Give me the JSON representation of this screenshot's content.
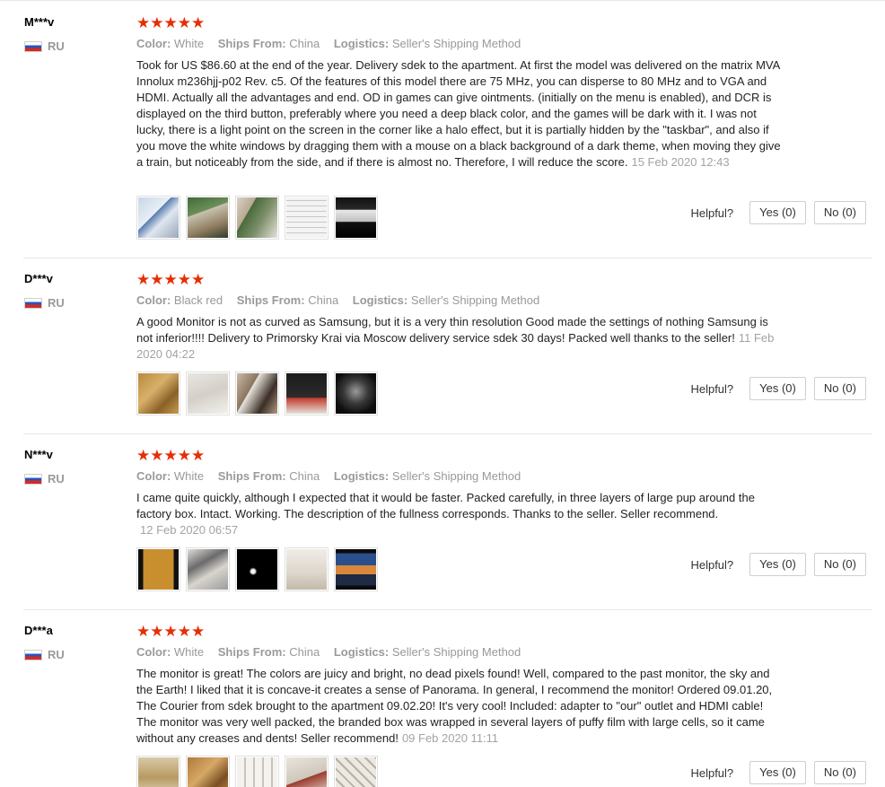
{
  "reviews": [
    {
      "user": "M***v",
      "country": "RU",
      "rating": "★★★★★",
      "color_label": "Color:",
      "color": "White",
      "ships_label": "Ships From:",
      "ships": "China",
      "logistics_label": "Logistics:",
      "logistics": "Seller's Shipping Method",
      "text": "Took for US $86.60 at the end of the year. Delivery sdek to the apartment. At first the model was delivered on the matrix MVA Innolux m236hjj-p02 Rev. c5. Of the features of this model there are 75 MHz, you can disperse to 80 MHz and to VGA and HDMI. Actually all the advantages and end. OD in games can give ointments. (initially on the menu is enabled), and DCR is displayed on the third button, preferably where you need a deep black color, and the games will be dark with it. I was not lucky, there is a light point on the screen in the corner like a halo effect, but it is partially hidden by the \"taskbar\", and also if you move the white windows by dragging them with a mouse on a black background of a dark theme, when moving they give a train, but noticeably from the side, and if there is almost no. Therefore, I will reduce the score.",
      "date": "15 Feb 2020 12:43",
      "helpful_label": "Helpful?",
      "yes_label": "Yes (0)",
      "no_label": "No (0)"
    },
    {
      "user": "D***v",
      "country": "RU",
      "rating": "★★★★★",
      "color_label": "Color:",
      "color": "Black red",
      "ships_label": "Ships From:",
      "ships": "China",
      "logistics_label": "Logistics:",
      "logistics": "Seller's Shipping Method",
      "text": "A good Monitor is not as curved as Samsung, but it is a very thin resolution Good made the settings of nothing Samsung is not inferior!!!! Delivery to Primorsky Krai via Moscow delivery service sdek 30 days! Packed well thanks to the seller!",
      "date": "11 Feb 2020 04:22",
      "helpful_label": "Helpful?",
      "yes_label": "Yes (0)",
      "no_label": "No (0)"
    },
    {
      "user": "N***v",
      "country": "RU",
      "rating": "★★★★★",
      "color_label": "Color:",
      "color": "White",
      "ships_label": "Ships From:",
      "ships": "China",
      "logistics_label": "Logistics:",
      "logistics": "Seller's Shipping Method",
      "text": "I came quite quickly, although I expected that it would be faster. Packed carefully, in three layers of large pup around the factory box. Intact. Working. The description of the fullness corresponds. Thanks to the seller. Seller recommend.",
      "date": "12 Feb 2020 06:57",
      "helpful_label": "Helpful?",
      "yes_label": "Yes (0)",
      "no_label": "No (0)"
    },
    {
      "user": "D***a",
      "country": "RU",
      "rating": "★★★★★",
      "color_label": "Color:",
      "color": "White",
      "ships_label": "Ships From:",
      "ships": "China",
      "logistics_label": "Logistics:",
      "logistics": "Seller's Shipping Method",
      "text": "The monitor is great! The colors are juicy and bright, no dead pixels found! Well, compared to the past monitor, the sky and the Earth! I liked that it is concave-it creates a sense of Panorama. In general, I recommend the monitor! Ordered 09.01.20, The Courier from sdek brought to the apartment 09.02.20! It's very cool! Included: adapter to \"our\" outlet and HDMI cable! The monitor was very well packed, the branded box was wrapped in several layers of puffy film with large cells, so it came without any creases and dents! Seller recommend!",
      "date": "09 Feb 2020 11:11",
      "helpful_label": "Helpful?",
      "yes_label": "Yes (0)",
      "no_label": "No (0)"
    }
  ],
  "colors": {
    "star": "#e62e04",
    "meta": "#999999",
    "date": "#a3a3a3"
  }
}
